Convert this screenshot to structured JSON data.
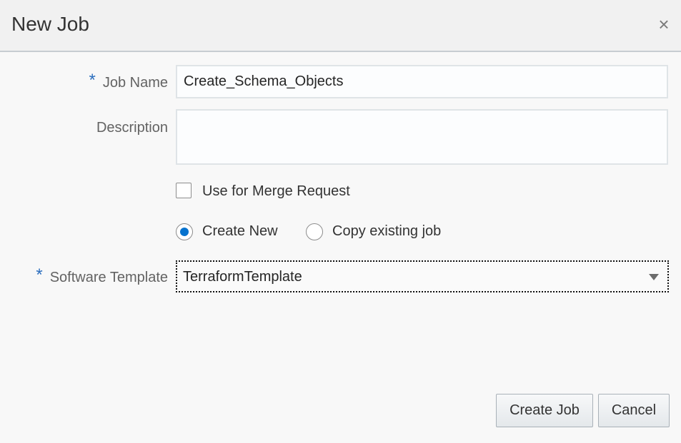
{
  "dialog": {
    "title": "New Job",
    "close_glyph": "×"
  },
  "form": {
    "job_name": {
      "label": "Job Name",
      "required_marker": "*",
      "value": "Create_Schema_Objects"
    },
    "description": {
      "label": "Description",
      "value": ""
    },
    "merge_request": {
      "label": "Use for Merge Request",
      "checked": false
    },
    "mode": {
      "create_new_label": "Create New",
      "copy_existing_label": "Copy existing job",
      "selected": "Create New"
    },
    "software_template": {
      "label": "Software Template",
      "required_marker": "*",
      "value": "TerraformTemplate"
    }
  },
  "buttons": {
    "create_job": "Create Job",
    "cancel": "Cancel"
  },
  "colors": {
    "accent": "#0572ce",
    "required": "#2c6ebe"
  }
}
